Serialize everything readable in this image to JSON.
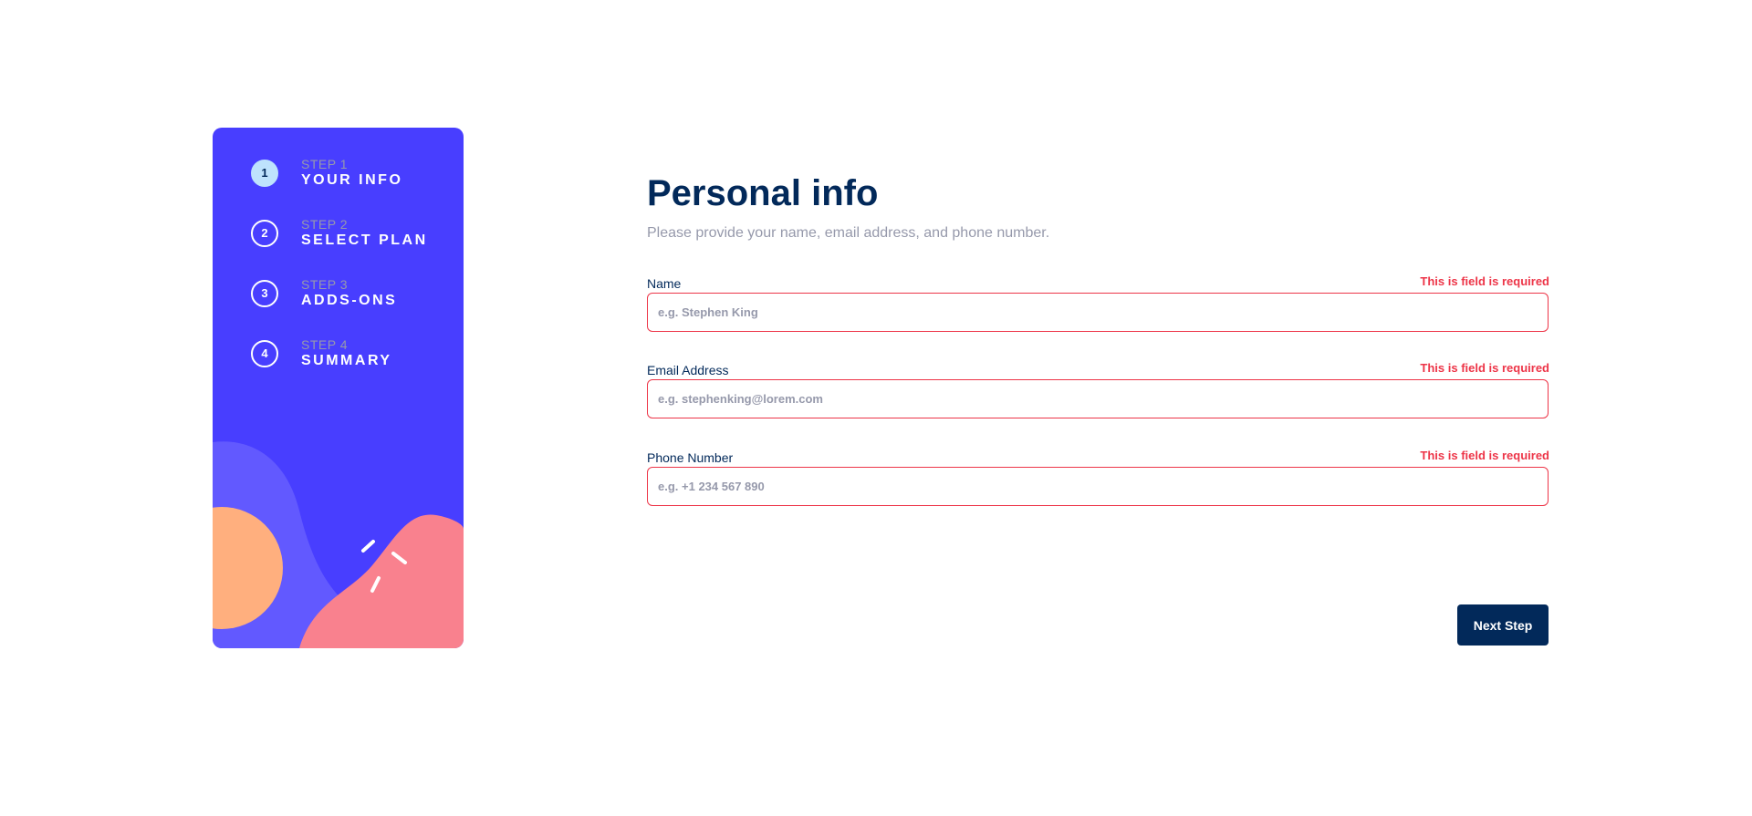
{
  "sidebar": {
    "steps": [
      {
        "number": "1",
        "small": "STEP 1",
        "big": "YOUR INFO",
        "active": true
      },
      {
        "number": "2",
        "small": "STEP 2",
        "big": "SELECT PLAN",
        "active": false
      },
      {
        "number": "3",
        "small": "STEP 3",
        "big": "ADDS-ONS",
        "active": false
      },
      {
        "number": "4",
        "small": "STEP 4",
        "big": "SUMMARY",
        "active": false
      }
    ]
  },
  "main": {
    "title": "Personal info",
    "subtitle": "Please provide your name, email address, and phone number.",
    "fields": {
      "name": {
        "label": "Name",
        "error": "This is field is required",
        "placeholder": "e.g. Stephen King",
        "value": ""
      },
      "email": {
        "label": "Email Address",
        "error": "This is field is required",
        "placeholder": "e.g. stephenking@lorem.com",
        "value": ""
      },
      "phone": {
        "label": "Phone Number",
        "error": "This is field is required",
        "placeholder": "e.g. +1 234 567 890",
        "value": ""
      }
    },
    "next_label": "Next Step"
  },
  "colors": {
    "sidebar_bg": "#483eff",
    "primary_text": "#02295a",
    "muted_text": "#9699ab",
    "error": "#ed3548",
    "active_step": "#bee2fd",
    "accent_orange": "#ffaf7e",
    "accent_pink": "#f9818e",
    "accent_purple": "#6259ff"
  }
}
